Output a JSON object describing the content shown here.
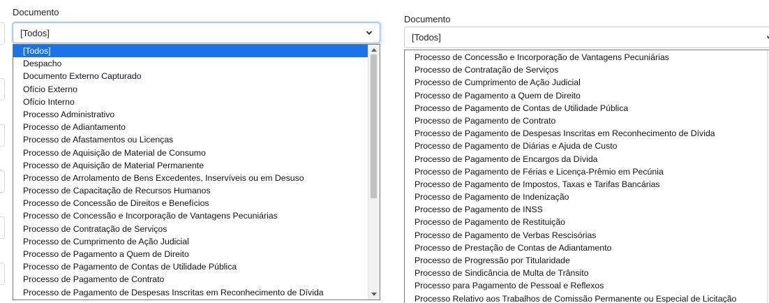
{
  "left": {
    "label": "Documento",
    "selected_value": "[Todos]",
    "options": [
      "[Todos]",
      "Despacho",
      "Documento Externo Capturado",
      "Ofício Externo",
      "Ofício Interno",
      "Processo Administrativo",
      "Processo de Adiantamento",
      "Processo de Afastamentos ou Licenças",
      "Processo de Aquisição de Material de Consumo",
      "Processo de Aquisição de Material Permanente",
      "Processo de Arrolamento de Bens Excedentes, Inservíveis ou em Desuso",
      "Processo de Capacitação de Recursos Humanos",
      "Processo de Concessão de Direitos e Benefícios",
      "Processo de Concessão e Incorporação de Vantagens Pecuniárias",
      "Processo de Contratação de Serviços",
      "Processo de Cumprimento de Ação Judicial",
      "Processo de Pagamento a Quem de Direito",
      "Processo de Pagamento de Contas de Utilidade Pública",
      "Processo de Pagamento de Contrato",
      "Processo de Pagamento de Despesas Inscritas em Reconhecimento de Dívida"
    ],
    "highlighted_option": "[Todos]"
  },
  "right": {
    "label": "Documento",
    "selected_value": "[Todos]",
    "options": [
      "Processo de Concessão e Incorporação de Vantagens Pecuniárias",
      "Processo de Contratação de Serviços",
      "Processo de Cumprimento de Ação Judicial",
      "Processo de Pagamento a Quem de Direito",
      "Processo de Pagamento de Contas de Utilidade Pública",
      "Processo de Pagamento de Contrato",
      "Processo de Pagamento de Despesas Inscritas em Reconhecimento de Dívida",
      "Processo de Pagamento de Diárias e Ajuda de Custo",
      "Processo de Pagamento de Encargos da Dívida",
      "Processo de Pagamento de Férias e Licença-Prêmio em Pecúnia",
      "Processo de Pagamento de Impostos, Taxas e Tarifas Bancárias",
      "Processo de Pagamento de Indenização",
      "Processo de Pagamento de INSS",
      "Processo de Pagamento de Restituição",
      "Processo de Pagamento de Verbas Rescisórias",
      "Processo de Prestação de Contas de Adiantamento",
      "Processo de Progressão por Titularidade",
      "Processo de Sindicância de Multa de Trânsito",
      "Processo para Pagamento de Pessoal e Reflexos",
      "Processo Relativo aos Trabalhos de Comissão Permanente ou Especial de Licitação"
    ]
  },
  "icons": {
    "dropdown": "chevron-down-icon",
    "scroll_up": "scroll-up-arrow-icon",
    "scroll_down": "scroll-down-arrow-icon"
  }
}
